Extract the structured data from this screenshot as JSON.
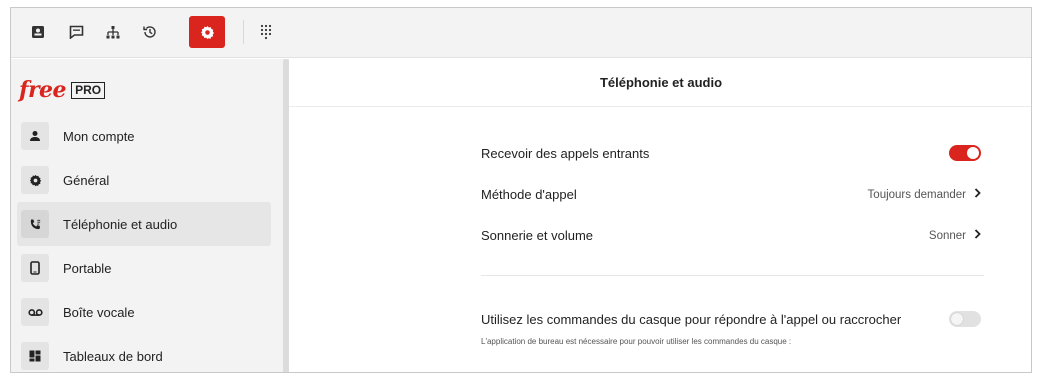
{
  "toolbar": {
    "icons": [
      "contact-card-icon",
      "chat-icon",
      "org-chart-icon",
      "history-icon",
      "settings-icon",
      "dialpad-icon"
    ],
    "accent": "#d9251d"
  },
  "logo": {
    "brand": "free",
    "pro": "PRO"
  },
  "sidebar": {
    "items": [
      {
        "label": "Mon compte",
        "icon": "person-icon"
      },
      {
        "label": "Général",
        "icon": "gear-icon"
      },
      {
        "label": "Téléphonie et audio",
        "icon": "phone-icon",
        "active": true
      },
      {
        "label": "Portable",
        "icon": "mobile-icon"
      },
      {
        "label": "Boîte vocale",
        "icon": "voicemail-icon"
      },
      {
        "label": "Tableaux de bord",
        "icon": "dashboard-icon"
      }
    ]
  },
  "main": {
    "title": "Téléphonie et audio",
    "settings": [
      {
        "label": "Recevoir des appels entrants",
        "toggle": true
      },
      {
        "label": "Méthode d'appel",
        "value": "Toujours demander"
      },
      {
        "label": "Sonnerie et volume",
        "value": "Sonner"
      }
    ],
    "headset": {
      "label": "Utilisez les commandes du casque pour répondre à l'appel ou raccrocher",
      "toggle": false,
      "note": "L'application de bureau est nécessaire pour pouvoir utiliser les commandes du casque :"
    }
  }
}
